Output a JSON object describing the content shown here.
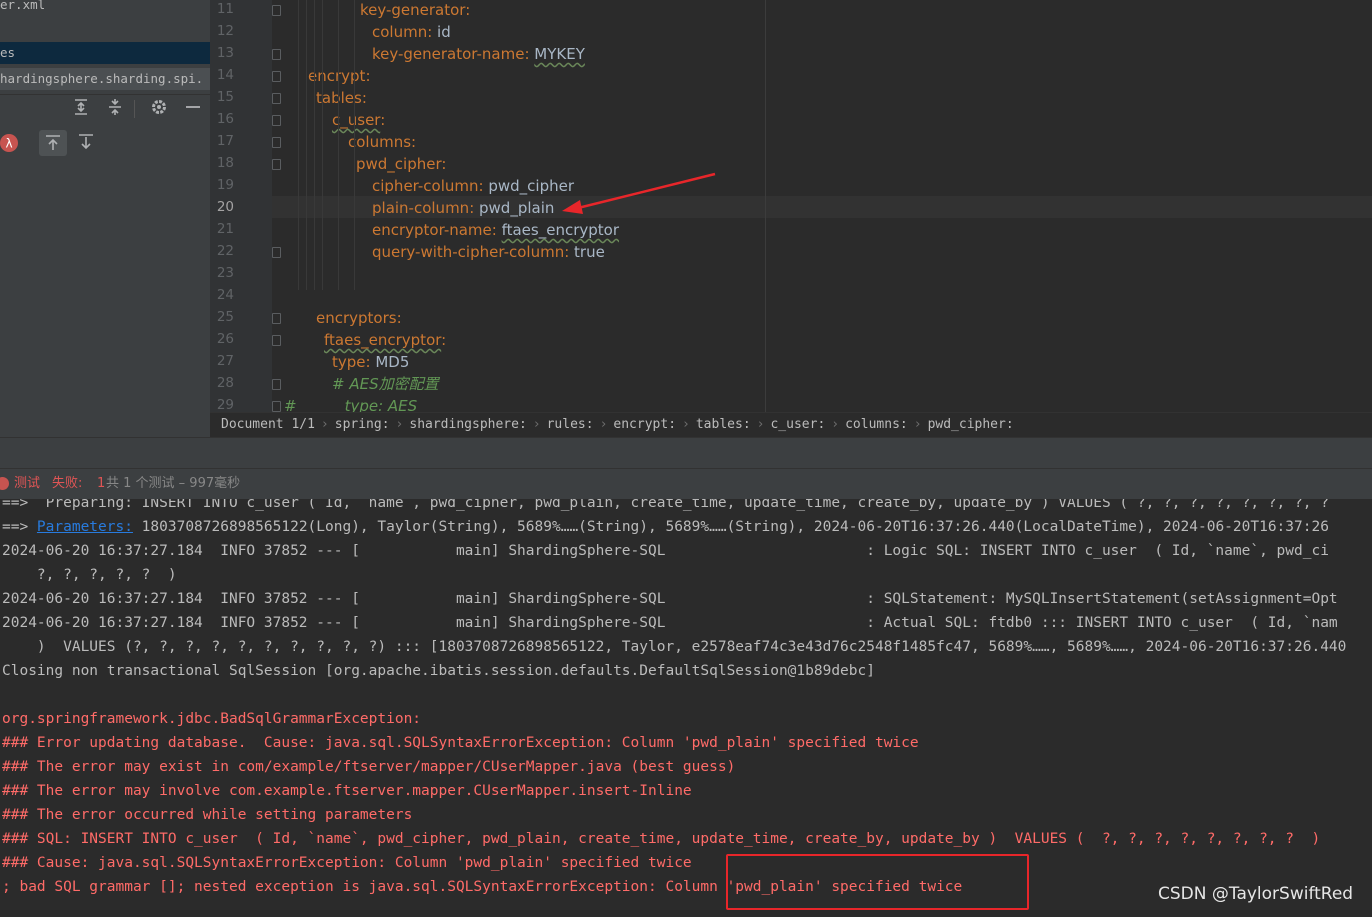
{
  "project_panel": {
    "rows": [
      {
        "text": "er.xml"
      },
      {
        "text": "es"
      },
      {
        "text": "hardingsphere.sharding.spi."
      }
    ]
  },
  "toolbar": {
    "expand_all_icon": "expand-all-icon",
    "collapse_all_icon": "collapse-all-icon",
    "settings_icon": "gear-icon",
    "hide_icon": "minimize-icon",
    "lambda_icon": "lambda-icon",
    "scroll_from_source_icon": "scroll-up-icon",
    "scroll_to_source_icon": "scroll-down-icon"
  },
  "editor": {
    "current_line": 20,
    "lines": [
      {
        "no": "11",
        "key": "key-generator",
        "sep": ":",
        "value": ""
      },
      {
        "no": "12",
        "key": "column",
        "sep": ": ",
        "value": "id"
      },
      {
        "no": "13",
        "key": "key-generator-name",
        "sep": ": ",
        "value": "MYKEY"
      },
      {
        "no": "14",
        "key": "encrypt",
        "sep": ":",
        "value": ""
      },
      {
        "no": "15",
        "key": "tables",
        "sep": ":",
        "value": ""
      },
      {
        "no": "16",
        "key": "c_user",
        "sep": ":",
        "value": ""
      },
      {
        "no": "17",
        "key": "columns",
        "sep": ":",
        "value": ""
      },
      {
        "no": "18",
        "key": "pwd_cipher",
        "sep": ":",
        "value": ""
      },
      {
        "no": "19",
        "key": "cipher-column",
        "sep": ": ",
        "value": "pwd_cipher"
      },
      {
        "no": "20",
        "key": "plain-column",
        "sep": ": ",
        "value": "pwd_plain"
      },
      {
        "no": "21",
        "key": "encryptor-name",
        "sep": ": ",
        "value": "ftaes_encryptor"
      },
      {
        "no": "22",
        "key": "query-with-cipher-column",
        "sep": ": ",
        "value": "true"
      },
      {
        "no": "23",
        "key": "",
        "sep": "",
        "value": ""
      },
      {
        "no": "24",
        "key": "",
        "sep": "",
        "value": ""
      },
      {
        "no": "25",
        "key": "encryptors",
        "sep": ":",
        "value": ""
      },
      {
        "no": "26",
        "key": "ftaes_encryptor",
        "sep": ":",
        "value": ""
      },
      {
        "no": "27",
        "key": "type",
        "sep": ": ",
        "value": "MD5"
      },
      {
        "no": "28",
        "comment": "# AES加密配置"
      },
      {
        "no": "29",
        "comment": "#",
        "comment2": "type: AES"
      }
    ],
    "annotation_arrow_color": "#e8262a"
  },
  "breadcrumb": {
    "document": "Document 1/1",
    "items": [
      "spring:",
      "shardingsphere:",
      "rules:",
      "encrypt:",
      "tables:",
      "c_user:",
      "columns:",
      "pwd_cipher:"
    ]
  },
  "test_status": {
    "label": "测试",
    "fail_label": "失败:",
    "fail_count": "1",
    "summary": "共 1 个测试 – 997毫秒"
  },
  "console": {
    "lines": [
      {
        "text": "==>  Preparing: INSERT INTO c_user ( Id, `name`, pwd_cipher, pwd_plain, create_time, update_time, create_by, update_by ) VALUES ( ?, ?, ?, ?, ?, ?, ?, ?",
        "type": "info"
      },
      {
        "prefix": "==> ",
        "link": "Parameters:",
        "text": " 1803708726898565122(Long), Taylor(String), 5689%……(String), 5689%……(String), 2024-06-20T16:37:26.440(LocalDateTime), 2024-06-20T16:37:26",
        "type": "params"
      },
      {
        "text": "2024-06-20 16:37:27.184  INFO 37852 --- [           main] ShardingSphere-SQL                       : Logic SQL: INSERT INTO c_user  ( Id, `name`, pwd_ci",
        "type": "info"
      },
      {
        "text": "    ?, ?, ?, ?, ?  )",
        "type": "info"
      },
      {
        "text": "2024-06-20 16:37:27.184  INFO 37852 --- [           main] ShardingSphere-SQL                       : SQLStatement: MySQLInsertStatement(setAssignment=Opt",
        "type": "info"
      },
      {
        "text": "2024-06-20 16:37:27.184  INFO 37852 --- [           main] ShardingSphere-SQL                       : Actual SQL: ftdb0 ::: INSERT INTO c_user  ( Id, `nam",
        "type": "info"
      },
      {
        "text": "    )  VALUES (?, ?, ?, ?, ?, ?, ?, ?, ?, ?) ::: [1803708726898565122, Taylor, e2578eaf74c3e43d76c2548f1485fc47, 5689%……, 5689%……, 2024-06-20T16:37:26.440",
        "type": "info"
      },
      {
        "text": "Closing non transactional SqlSession [org.apache.ibatis.session.defaults.DefaultSqlSession@1b89debc]",
        "type": "info"
      },
      {
        "text": "",
        "type": "info"
      },
      {
        "text": "org.springframework.jdbc.BadSqlGrammarException: ",
        "type": "err"
      },
      {
        "text": "### Error updating database.  Cause: java.sql.SQLSyntaxErrorException: Column 'pwd_plain' specified twice",
        "type": "err"
      },
      {
        "text": "### The error may exist in com/example/ftserver/mapper/CUserMapper.java (best guess)",
        "type": "err"
      },
      {
        "text": "### The error may involve com.example.ftserver.mapper.CUserMapper.insert-Inline",
        "type": "err"
      },
      {
        "text": "### The error occurred while setting parameters",
        "type": "err"
      },
      {
        "text": "### SQL: INSERT INTO c_user  ( Id, `name`, pwd_cipher, pwd_plain, create_time, update_time, create_by, update_by )  VALUES (  ?, ?, ?, ?, ?, ?, ?, ?  )",
        "type": "err"
      },
      {
        "text": "### Cause: java.sql.SQLSyntaxErrorException: Column 'pwd_plain' specified twice",
        "type": "err"
      },
      {
        "text": "; bad SQL grammar []; nested exception is java.sql.SQLSyntaxErrorException: Column 'pwd_plain' specified twice",
        "type": "err"
      }
    ],
    "highlight_color": "#e8262a"
  },
  "watermark": "CSDN @TaylorSwiftRed"
}
